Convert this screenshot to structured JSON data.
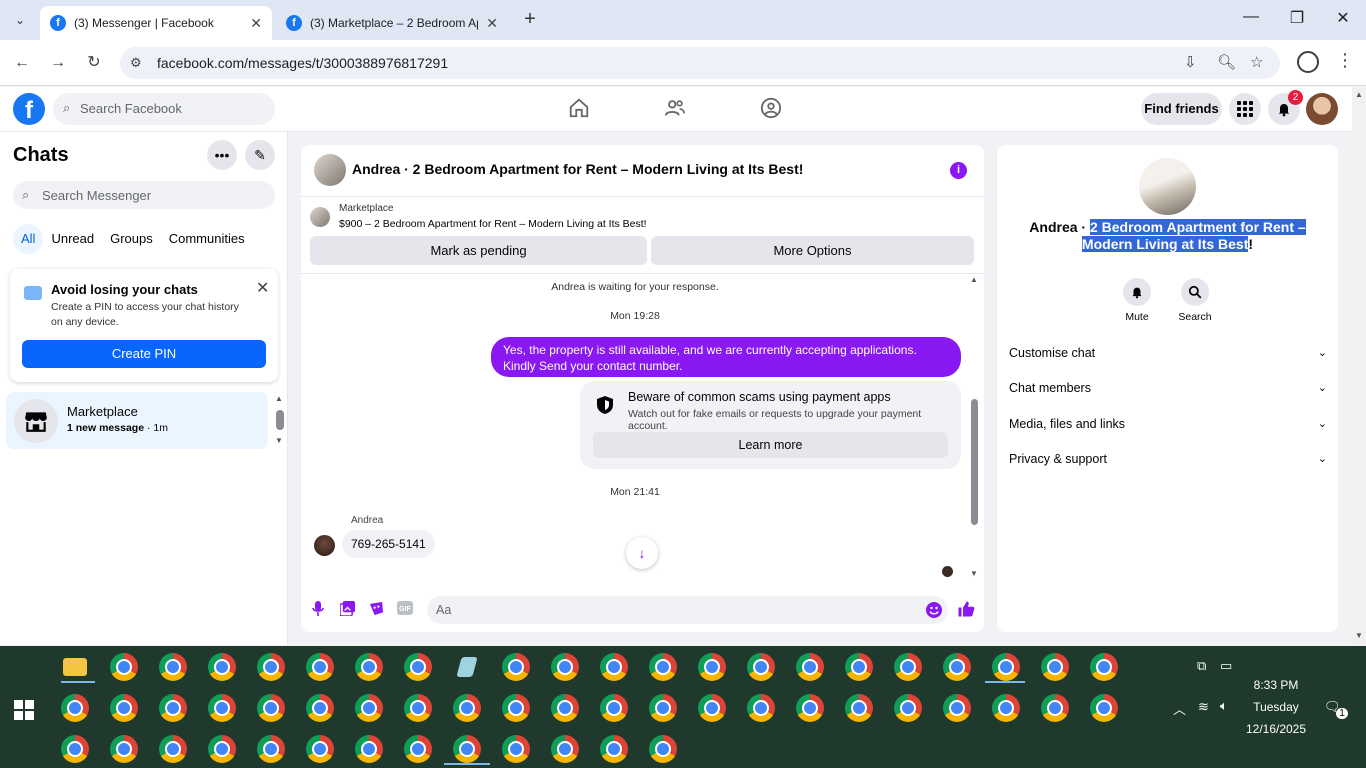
{
  "browser": {
    "tabs": [
      {
        "title": "(3) Messenger | Facebook",
        "active": true
      },
      {
        "title": "(3) Marketplace – 2 Bedroom Ap",
        "active": false
      }
    ],
    "url": "facebook.com/messages/t/3000388976817291"
  },
  "fb_header": {
    "logo": "f",
    "search_placeholder": "Search Facebook",
    "find_friends": "Find friends",
    "notification_count": "2"
  },
  "sidebar": {
    "title": "Chats",
    "search_placeholder": "Search Messenger",
    "filters": [
      "All",
      "Unread",
      "Groups",
      "Communities"
    ],
    "pin_card": {
      "title": "Avoid losing your chats",
      "body": "Create a PIN to access your chat history on any device.",
      "button": "Create PIN"
    },
    "chats": [
      {
        "name": "Marketplace",
        "unread": "1 new message",
        "time": " · 1m"
      }
    ]
  },
  "conversation": {
    "title": "Andrea · 2 Bedroom Apartment for Rent – Modern Living at Its Best!",
    "marketplace": {
      "label": "Marketplace",
      "listing": "$900 – 2 Bedroom Apartment for Rent – Modern Living at Its Best!",
      "mark_pending": "Mark as pending",
      "more_options": "More Options"
    },
    "waiting_text": "Andrea is waiting for your response.",
    "time1": "Mon 19:28",
    "outgoing_message": "Yes, the property is still available, and we are currently accepting applications. Kindly Send your contact number.",
    "warning": {
      "title": "Beware of common scams using payment apps",
      "subtitle": "Watch out for fake emails or requests to upgrade your payment account.",
      "button": "Learn more"
    },
    "time2": "Mon 21:41",
    "incoming_sender": "Andrea",
    "incoming_message": "769-265-5141",
    "composer_placeholder": "Aa"
  },
  "right_panel": {
    "title_plain": "Andrea · ",
    "title_highlight1": "2 Bedroom Apartment for Rent –",
    "title_highlight2": "Modern Living at Its Best",
    "title_tail": "!",
    "actions": [
      "Mute",
      "Search"
    ],
    "sections": [
      "Customise chat",
      "Chat members",
      "Media, files and links",
      "Privacy & support"
    ]
  },
  "taskbar": {
    "time": "8:33 PM",
    "day": "Tuesday",
    "date": "12/16/2025",
    "notifications": "1"
  }
}
